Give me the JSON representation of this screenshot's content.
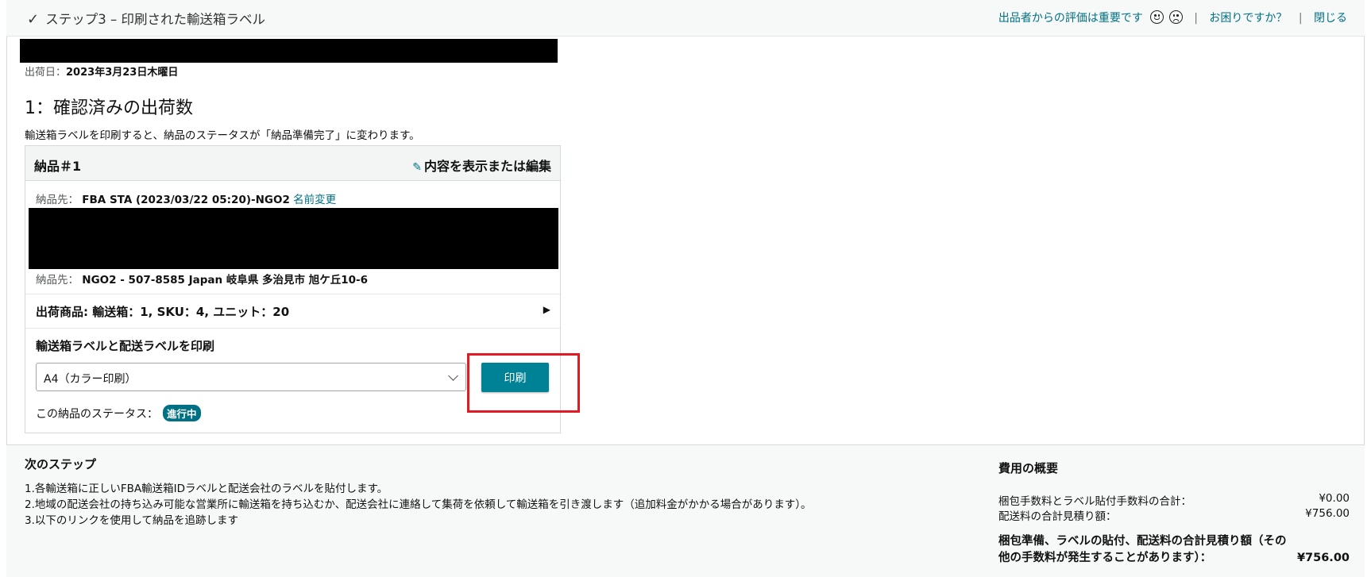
{
  "header": {
    "step_title": "ステップ3 – 印刷された輸送箱ラベル",
    "feedback_label": "出品者からの評価は重要です",
    "help_link": "お困りですか？",
    "close_link": "閉じる",
    "separator": "|"
  },
  "shipment": {
    "ship_date_label": "出荷日：",
    "ship_date_value": "2023年3月23日木曜日",
    "section_title": "1：確認済みの出荷数",
    "section_note": "輸送箱ラベルを印刷すると、納品のステータスが「納品準備完了」に変わります。"
  },
  "card": {
    "name": "納品＃1",
    "edit_label": "内容を表示または編集",
    "dest_label_1": "納品先：",
    "dest_value_1": "FBA STA (2023/03/22 05:20)-NGO2",
    "rename_link": "名前変更",
    "dest_label_2": "納品先：",
    "dest_value_2": "NGO2 -  507-8585 Japan 岐阜県 多治見市 旭ケ丘10-6",
    "items_summary": "出荷商品: 輸送箱：1, SKU：4, ユニット：20",
    "print_label": "輸送箱ラベルと配送ラベルを印刷",
    "paper_select_value": "A4（カラー印刷）",
    "print_button": "印刷",
    "status_label": "この納品のステータス：",
    "status_badge": "進行中"
  },
  "next_steps": {
    "title": "次のステップ",
    "items": [
      "1.各輸送箱に正しいFBA輸送箱IDラベルと配送会社のラベルを貼付します。",
      "2.地域の配送会社の持ち込み可能な営業所に輸送箱を持ち込むか、配送会社に連絡して集荷を依頼して輸送箱を引き渡します（追加料金がかかる場合があります）。",
      "3.以下のリンクを使用して納品を追跡します"
    ]
  },
  "cost_summary": {
    "title": "費用の概要",
    "fee_label": "梱包手数料とラベル貼付手数料の合計：",
    "fee_value": "¥0.00",
    "shipping_label": "配送料の合計見積り額：",
    "shipping_value": "¥756.00",
    "total_label": "梱包準備、ラベルの貼付、配送料の合計見積り額（その他の手数料が発生することがあります）：",
    "total_value": "¥756.00"
  },
  "colors": {
    "link": "#007185",
    "primary_button": "#008296",
    "highlight": "#e21b23"
  }
}
